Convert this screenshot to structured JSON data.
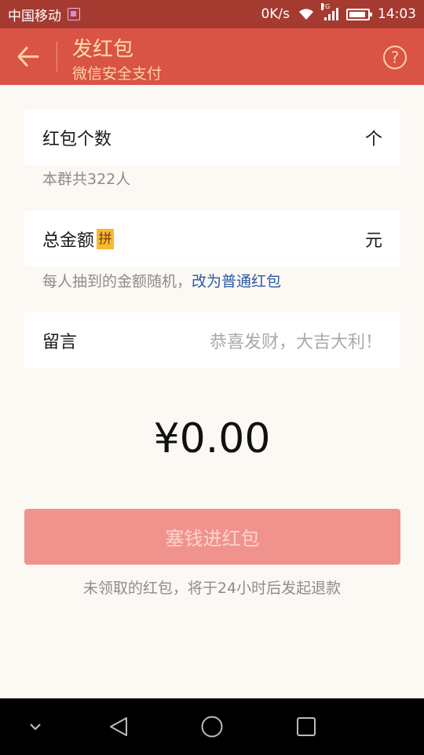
{
  "status_bar": {
    "carrier": "中国移动",
    "network_speed": "0K/s",
    "network_type": "2G",
    "time": "14:03"
  },
  "header": {
    "title": "发红包",
    "subtitle": "微信安全支付",
    "back_icon": "arrow-left-icon",
    "help_icon": "question-circle-icon",
    "help_glyph": "?",
    "colors": {
      "bar": "#d95346",
      "text": "#ffdcaa",
      "status_bar": "#a43a30"
    }
  },
  "form": {
    "count": {
      "label": "红包个数",
      "unit": "个",
      "hint": "本群共322人"
    },
    "amount": {
      "label": "总金额",
      "badge": "拼",
      "unit": "元",
      "hint_text": "每人抽到的金额随机，",
      "hint_link": "改为普通红包"
    },
    "message": {
      "label": "留言",
      "placeholder": "恭喜发财，大吉大利！"
    }
  },
  "total": {
    "display": "¥0.00"
  },
  "submit": {
    "label": "塞钱进红包",
    "color": "#f0938c"
  },
  "refund_note": "未领取的红包，将于24小时后发起退款",
  "nav": [
    "chevron-down-icon",
    "back-triangle-icon",
    "home-circle-icon",
    "recents-square-icon"
  ]
}
